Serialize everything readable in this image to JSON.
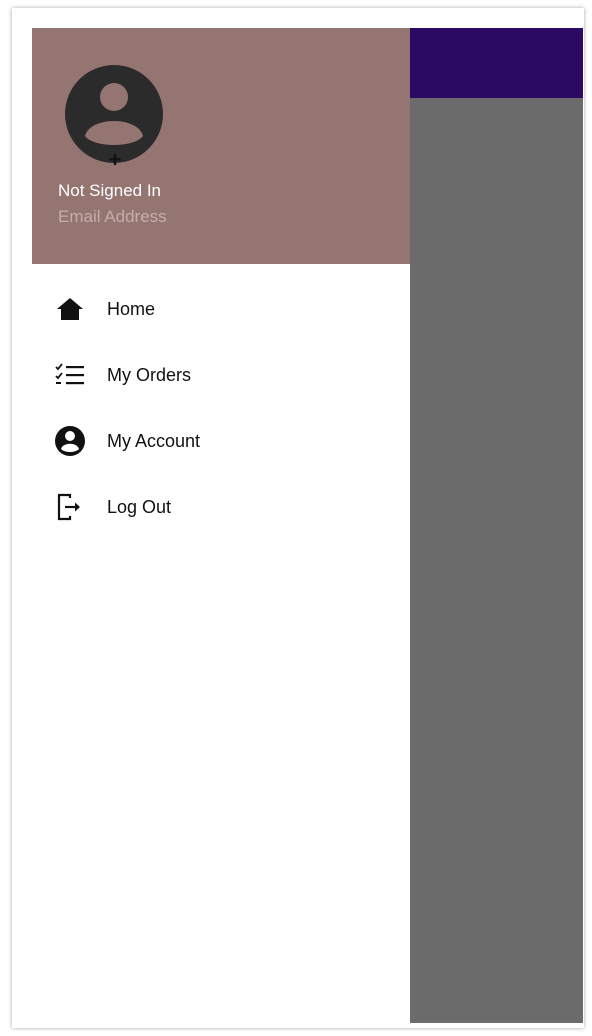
{
  "colors": {
    "header_bg": "#957571",
    "app_bar": "#2a0a63",
    "scrim": "#6b6b6b",
    "text_primary": "#111111",
    "email_text": "#c4aeaa"
  },
  "header": {
    "avatar_icon": "account-circle-icon",
    "add_icon": "plus-icon",
    "user_name": "Not Signed In",
    "email_placeholder": "Email Address"
  },
  "menu": {
    "items": [
      {
        "icon": "home-icon",
        "label": "Home"
      },
      {
        "icon": "checklist-icon",
        "label": "My Orders"
      },
      {
        "icon": "account-circle-icon",
        "label": "My Account"
      },
      {
        "icon": "logout-icon",
        "label": "Log Out"
      }
    ]
  }
}
